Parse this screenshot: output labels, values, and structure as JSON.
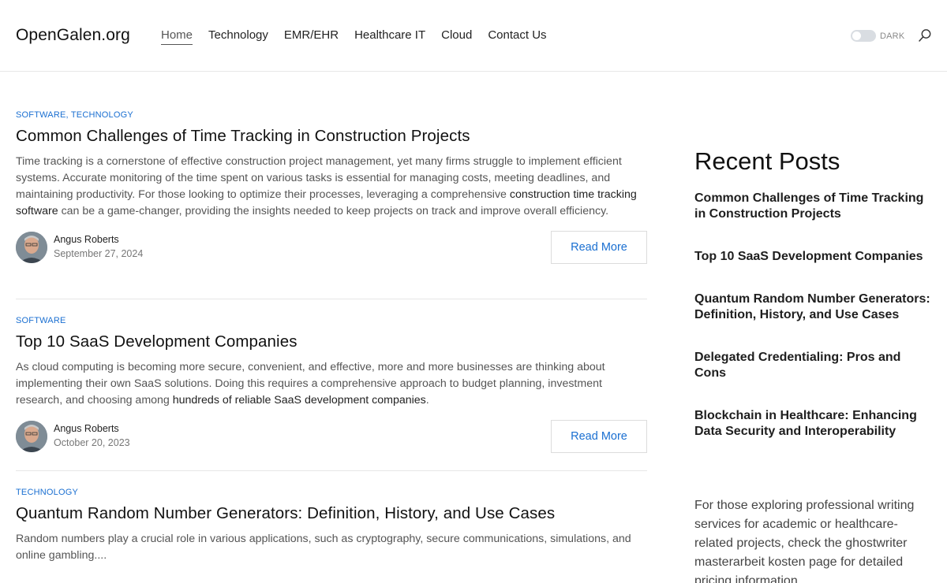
{
  "site": {
    "logo": "OpenGalen.org"
  },
  "nav": [
    {
      "label": "Home",
      "active": true
    },
    {
      "label": "Technology"
    },
    {
      "label": "EMR/EHR"
    },
    {
      "label": "Healthcare IT"
    },
    {
      "label": "Cloud"
    },
    {
      "label": "Contact Us"
    }
  ],
  "header": {
    "theme_toggle_label": "DARK"
  },
  "posts": [
    {
      "categories": [
        "SOFTWARE",
        "TECHNOLOGY"
      ],
      "title": "Common Challenges of Time Tracking in Construction Projects",
      "excerpt_before": "Time tracking is a cornerstone of effective construction project management, yet many firms struggle to implement efficient systems. Accurate monitoring of the time spent on various tasks is essential for managing costs, meeting deadlines, and maintaining productivity. For those looking to optimize their processes, leveraging a comprehensive ",
      "excerpt_link": "construction time tracking software",
      "excerpt_after": " can be a game-changer, providing the insights needed to keep projects on track and improve overall efficiency.",
      "author": "Angus Roberts",
      "date": "September 27, 2024",
      "read_more": "Read More"
    },
    {
      "categories": [
        "SOFTWARE"
      ],
      "title": "Top 10 SaaS Development Companies",
      "excerpt_before": "As cloud computing is becoming more secure, convenient, and effective, more and more businesses are thinking about implementing their own SaaS solutions. Doing this requires a comprehensive approach to budget planning, investment research, and choosing among ",
      "excerpt_link": "hundreds of reliable SaaS development companies",
      "excerpt_after": ".",
      "author": "Angus Roberts",
      "date": "October 20, 2023",
      "read_more": "Read More"
    },
    {
      "categories": [
        "TECHNOLOGY"
      ],
      "title": "Quantum Random Number Generators: Definition, History, and Use Cases",
      "excerpt_before": "Random numbers play a crucial role in various applications, such as cryptography, secure communications, simulations, and online gambling....",
      "excerpt_link": "",
      "excerpt_after": ""
    }
  ],
  "sidebar": {
    "title": "Recent Posts",
    "items": [
      "Common Challenges of Time Tracking in Construction Projects",
      "Top 10 SaaS Development Companies",
      "Quantum Random Number Generators: Definition, History, and Use Cases",
      "Delegated Credentialing: Pros and Cons",
      "Blockchain in Healthcare: Enhancing Data Security and Interoperability"
    ],
    "promo_text": "For those exploring professional writing services for academic or healthcare-related projects, check the ghostwriter masterarbeit kosten page for detailed pricing information."
  },
  "colors": {
    "accent": "#1a6fd1",
    "text": "#111111",
    "muted": "#555555"
  },
  "icons": {
    "search": "search-icon",
    "avatar": "avatar"
  }
}
